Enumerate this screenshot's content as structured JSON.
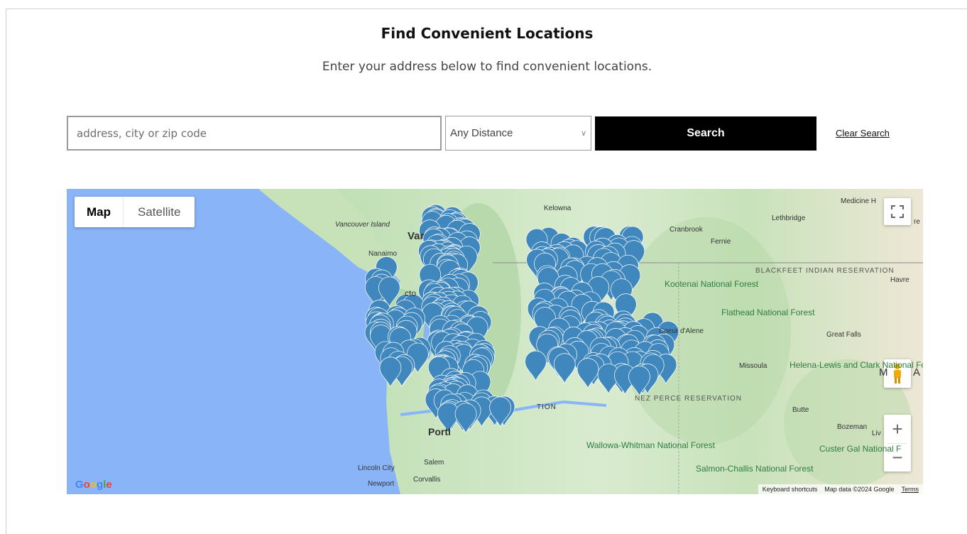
{
  "header": {
    "title": "Find Convenient Locations",
    "subtitle": "Enter your address below to find convenient locations."
  },
  "search": {
    "placeholder": "address, city or zip code",
    "distance_value": "Any Distance",
    "search_label": "Search",
    "clear_label": "Clear Search"
  },
  "map": {
    "type_buttons": [
      "Map",
      "Satellite"
    ],
    "zoom_in": "+",
    "zoom_out": "−",
    "google_logo": "Google",
    "attribution": {
      "shortcuts": "Keyboard shortcuts",
      "data": "Map data ©2024 Google",
      "terms": "Terms"
    },
    "places": [
      "Kelowna",
      "Vancouver Island",
      "Var",
      "Nanaimo",
      "cto",
      "Cranbrook",
      "Fernie",
      "Lethbridge",
      "Medicine H",
      "Havre",
      "Coeur d'Alene",
      "Great Falls",
      "Missoula",
      "Butte",
      "Bozeman",
      "Liv",
      "Portl",
      "Salem",
      "Lincoln City",
      "Newport",
      "Corvallis",
      "TION",
      "M",
      "A",
      "re"
    ],
    "regions": [
      "Kootenai National Forest",
      "Flathead National Forest",
      "Helena-Lewis and Clark National Forest",
      "Wallowa-Whitman National Forest",
      "Salmon-Challis National Forest",
      "Custer Gal National F",
      "BLACKFEET INDIAN RESERVATION",
      "NEZ PERCE RESERVATION"
    ],
    "colors": {
      "water": "#8ab4f8",
      "land": "#cfe6c3",
      "pin": "#3f87bd"
    }
  }
}
